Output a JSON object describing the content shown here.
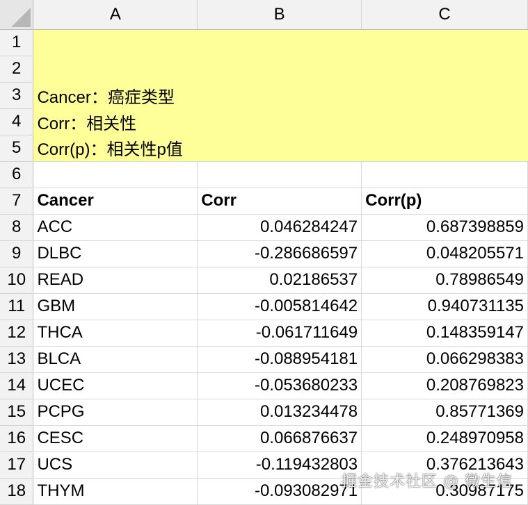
{
  "columns": [
    "A",
    "B",
    "C"
  ],
  "rows": [
    "1",
    "2",
    "3",
    "4",
    "5",
    "6",
    "7",
    "8",
    "9",
    "10",
    "11",
    "12",
    "13",
    "14",
    "15",
    "16",
    "17",
    "18"
  ],
  "legend": {
    "line3": "Cancer：癌症类型",
    "line4": "Corr：相关性",
    "line5": "Corr(p)：相关性p值"
  },
  "headers": [
    "Cancer",
    "Corr",
    "Corr(p)"
  ],
  "data": [
    [
      "ACC",
      "0.046284247",
      "0.687398859"
    ],
    [
      "DLBC",
      "-0.286686597",
      "0.048205571"
    ],
    [
      "READ",
      "0.02186537",
      "0.78986549"
    ],
    [
      "GBM",
      "-0.005814642",
      "0.940731135"
    ],
    [
      "THCA",
      "-0.061711649",
      "0.148359147"
    ],
    [
      "BLCA",
      "-0.088954181",
      "0.066298383"
    ],
    [
      "UCEC",
      "-0.053680233",
      "0.208769823"
    ],
    [
      "PCPG",
      "0.013234478",
      "0.85771369"
    ],
    [
      "CESC",
      "0.066876637",
      "0.248970958"
    ],
    [
      "UCS",
      "-0.119432803",
      "0.376213643"
    ],
    [
      "THYM",
      "-0.093082971",
      "0.30987175"
    ]
  ],
  "watermark": "掘金技术社区 @ 微生信",
  "colors": {
    "highlight": "#ffff99",
    "header_bg": "#f2f2f2"
  }
}
